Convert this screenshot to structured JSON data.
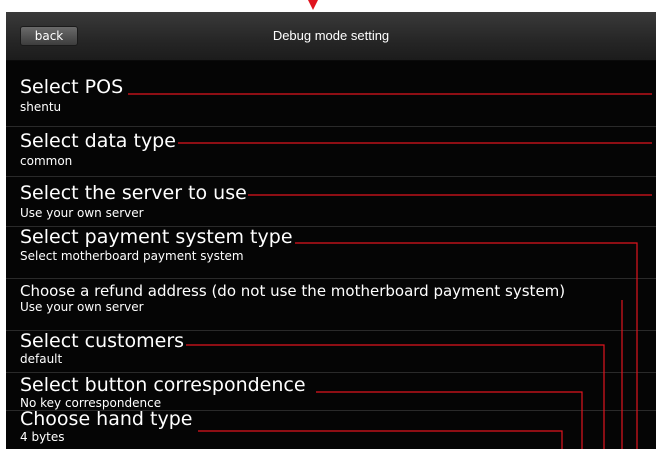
{
  "header": {
    "back_label": "back",
    "title": "Debug mode setting"
  },
  "settings": [
    {
      "title": "Select POS",
      "value": "shentu"
    },
    {
      "title": "Select data type",
      "value": "common"
    },
    {
      "title": "Select the server to use",
      "value": "Use your own server"
    },
    {
      "title": "Select payment system type",
      "value": "Select motherboard payment system"
    },
    {
      "title": "Choose a refund address (do not use the motherboard payment system)",
      "value": "Use your own server"
    },
    {
      "title": "Select customers",
      "value": "default"
    },
    {
      "title": "Select button correspondence",
      "value": "No key correspondence"
    },
    {
      "title": "Choose hand type",
      "value": "4 bytes"
    }
  ],
  "colors": {
    "background": "#050505",
    "annotation": "#e0141e",
    "text": "#ffffff"
  }
}
